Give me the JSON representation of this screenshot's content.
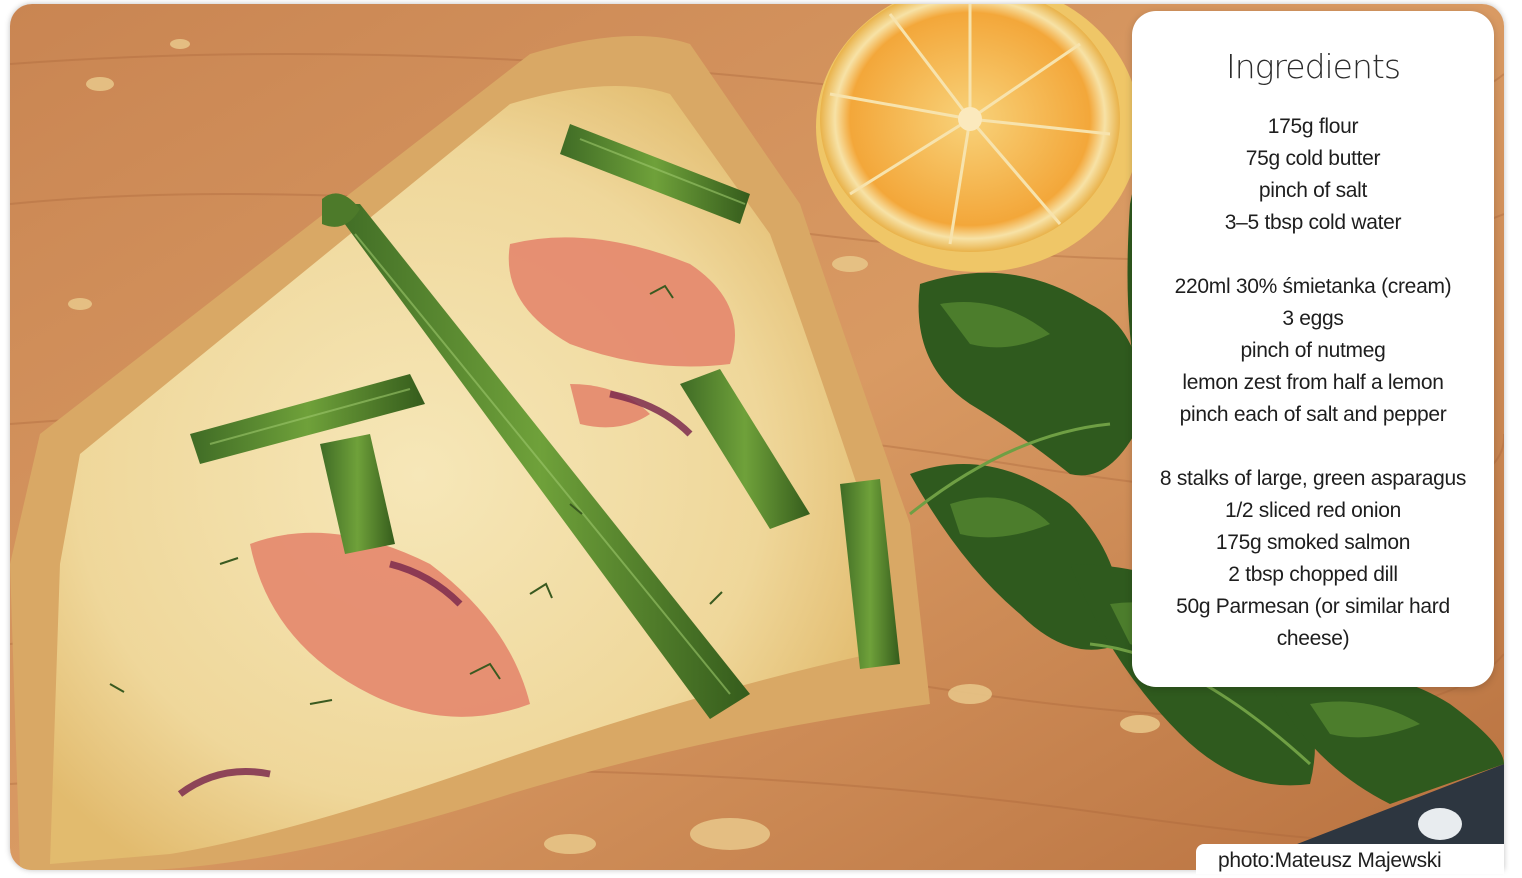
{
  "card": {
    "title": "Ingredients",
    "groups": [
      [
        "175g flour",
        "75g cold butter",
        "pinch of salt",
        "3–5 tbsp cold water"
      ],
      [
        "220ml 30% śmietanka (cream)",
        "3 eggs",
        "pinch of nutmeg",
        "lemon zest from half a lemon",
        "pinch each of salt and pepper"
      ],
      [
        "8 stalks of large, green asparagus",
        "1/2 sliced red onion",
        "175g smoked salmon",
        "2 tbsp chopped dill",
        "50g Parmesan (or similar hard cheese)"
      ]
    ]
  },
  "photo_credit": "photo:Mateusz Majewski"
}
